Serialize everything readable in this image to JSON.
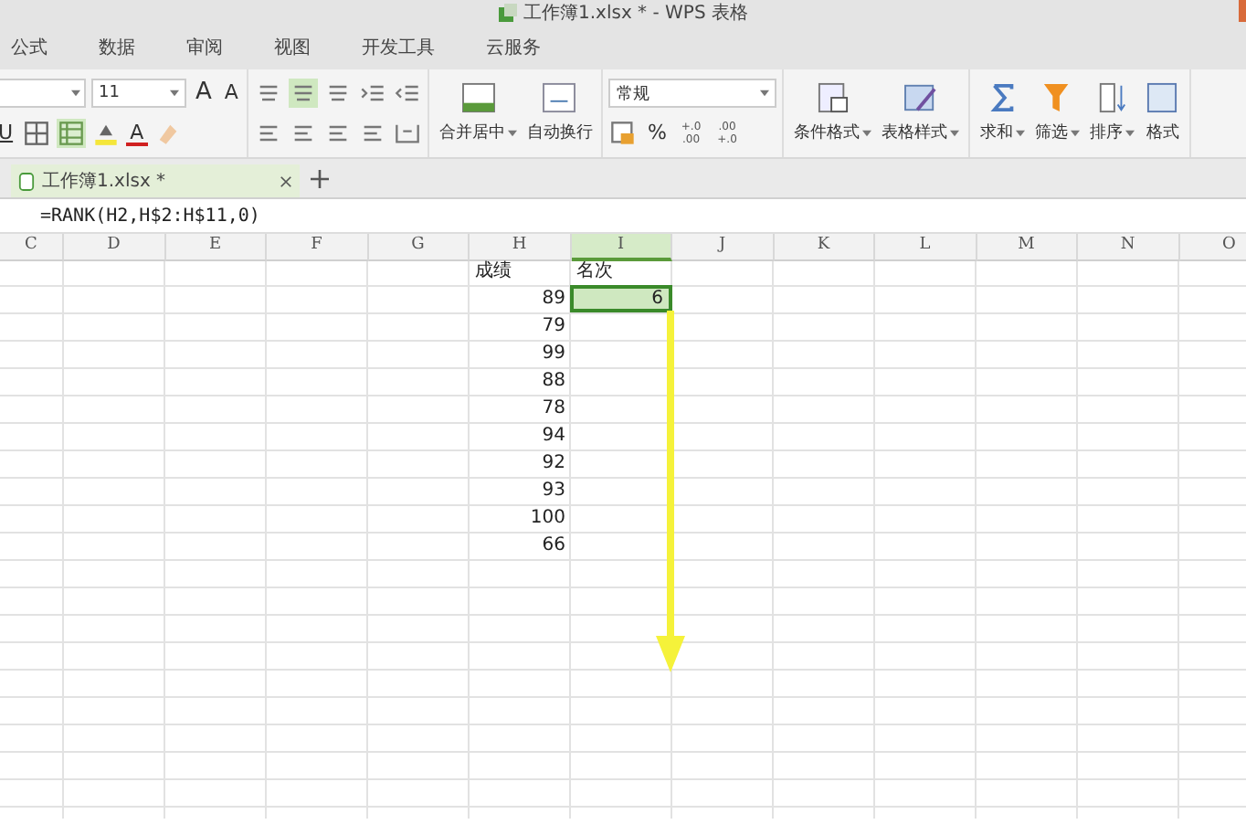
{
  "window": {
    "title": "工作簿1.xlsx * - WPS 表格"
  },
  "menu": [
    "公式",
    "数据",
    "审阅",
    "视图",
    "开发工具",
    "云服务"
  ],
  "ribbon": {
    "font_size": "11",
    "grow_font": "A",
    "shrink_font": "A",
    "underline": "U",
    "font_color": "A",
    "valign": [
      {
        "selected": false
      },
      {
        "selected": true
      },
      {
        "selected": false
      }
    ],
    "merge": "合并居中",
    "wrap": "自动换行",
    "number_format": "常规",
    "percent": "%",
    "increase_decimal": [
      "+.0",
      ".00"
    ],
    "decrease_decimal": [
      ".00",
      "+.0"
    ],
    "conditional": "条件格式",
    "table_style": "表格样式",
    "sum": "求和",
    "filter": "筛选",
    "sort": "排序",
    "format": "格式"
  },
  "tabs": [
    {
      "label": "工作簿1.xlsx *",
      "selected": true
    }
  ],
  "formula": "=RANK(H2,H$2:H$11,0)",
  "sheet": {
    "columns": [
      {
        "label": "C",
        "selected": false
      },
      {
        "label": "D",
        "selected": false
      },
      {
        "label": "E",
        "selected": false
      },
      {
        "label": "F",
        "selected": false
      },
      {
        "label": "G",
        "selected": false
      },
      {
        "label": "H",
        "selected": false
      },
      {
        "label": "I",
        "selected": true
      },
      {
        "label": "J",
        "selected": false
      },
      {
        "label": "K",
        "selected": false
      },
      {
        "label": "L",
        "selected": false
      },
      {
        "label": "M",
        "selected": false
      },
      {
        "label": "N",
        "selected": false
      },
      {
        "label": "O",
        "selected": false
      }
    ],
    "rows": [
      {
        "kind": "label",
        "col_h": "成绩",
        "col_i": "名次",
        "selected": false
      },
      {
        "kind": "value",
        "col_h": "89",
        "col_i": "6",
        "selected": true
      },
      {
        "kind": "value",
        "col_h": "79",
        "selected": false
      },
      {
        "kind": "value",
        "col_h": "99",
        "selected": false
      },
      {
        "kind": "value",
        "col_h": "88",
        "selected": false
      },
      {
        "kind": "value",
        "col_h": "78",
        "selected": false
      },
      {
        "kind": "value",
        "col_h": "94",
        "selected": false
      },
      {
        "kind": "value",
        "col_h": "92",
        "selected": false
      },
      {
        "kind": "value",
        "col_h": "93",
        "selected": false
      },
      {
        "kind": "value",
        "col_h": "100",
        "selected": false
      },
      {
        "kind": "value",
        "col_h": "66",
        "selected": false
      }
    ]
  }
}
